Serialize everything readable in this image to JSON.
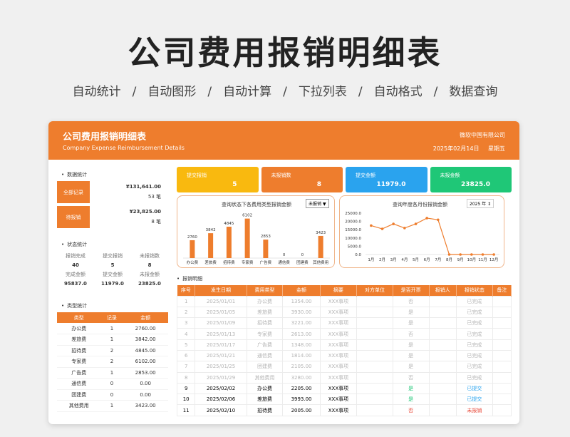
{
  "hero": {
    "title": "公司费用报销明细表",
    "features": [
      "自动统计",
      "/",
      "自动图形",
      "/",
      "自动计算",
      "/",
      "下拉列表",
      "/",
      "自动格式",
      "/",
      "数据查询"
    ]
  },
  "header": {
    "title": "公司费用报销明细表",
    "subtitle": "Company Expense Reimbursement Details",
    "company": "微软中国有限公司",
    "date": "2025年02月14日",
    "weekday": "星期五"
  },
  "left": {
    "data_stats_title": "数据统计",
    "all_records_label": "全部记录",
    "all_amount": "¥131,641.00",
    "all_count": "53 笔",
    "pending_label": "待报销",
    "pending_amount": "¥23,825.00",
    "pending_count": "8 笔",
    "status_title": "状态统计",
    "status_labels": [
      "报销完成",
      "提交报销",
      "未报销数"
    ],
    "status_counts": [
      "40",
      "5",
      "8"
    ],
    "amount_labels": [
      "完成金额",
      "提交金额",
      "未报金额"
    ],
    "amount_values": [
      "95837.0",
      "11979.0",
      "23825.0"
    ],
    "type_title": "类型统计",
    "type_headers": [
      "类型",
      "记录",
      "金额"
    ],
    "type_rows": [
      [
        "办公费",
        "1",
        "2760.00"
      ],
      [
        "差旅费",
        "1",
        "3842.00"
      ],
      [
        "招待费",
        "2",
        "4845.00"
      ],
      [
        "专家费",
        "2",
        "6102.00"
      ],
      [
        "广告费",
        "1",
        "2853.00"
      ],
      [
        "通信费",
        "0",
        "0.00"
      ],
      [
        "团建费",
        "0",
        "0.00"
      ],
      [
        "其他费用",
        "1",
        "3423.00"
      ]
    ]
  },
  "kpis": [
    {
      "label": "提交报销",
      "value": "5",
      "color": "#f9b90f"
    },
    {
      "label": "未报销数",
      "value": "8",
      "color": "#ee7d2d"
    },
    {
      "label": "提交金额",
      "value": "11979.0",
      "color": "#2aa3ee"
    },
    {
      "label": "未报金额",
      "value": "23825.0",
      "color": "#1fc777"
    }
  ],
  "bar_chart_meta": {
    "title": "查询状态下各费用类型报销金额",
    "filter": "未报销"
  },
  "line_chart_meta": {
    "title": "查询年度各月份报销金额",
    "year": "2025 年"
  },
  "chart_data": [
    {
      "type": "bar",
      "title": "查询状态下各费用类型报销金额",
      "categories": [
        "办公费",
        "差旅费",
        "招待费",
        "专家费",
        "广告费",
        "通信费",
        "团建费",
        "其他费用"
      ],
      "values": [
        2760,
        3842,
        4845,
        6102,
        2853,
        0,
        0,
        3423
      ],
      "ylim": [
        0,
        6500
      ],
      "color": "#ee7d2d"
    },
    {
      "type": "line",
      "title": "查询年度各月份报销金额",
      "categories": [
        "1月",
        "2月",
        "3月",
        "4月",
        "5月",
        "6月",
        "7月",
        "8月",
        "9月",
        "10月",
        "11月",
        "12月"
      ],
      "values": [
        17500,
        15500,
        18500,
        16000,
        18500,
        22000,
        21000,
        0,
        0,
        0,
        0,
        0
      ],
      "yticks": [
        "25000.0",
        "20000.0",
        "15000.0",
        "10000.0",
        "5000.0",
        "0.0"
      ],
      "ylim": [
        0,
        25000
      ],
      "color": "#ee7d2d"
    }
  ],
  "detail": {
    "title": "报销明细",
    "headers": [
      "序号",
      "发生日期",
      "费用类型",
      "金额",
      "摘要",
      "对方单位",
      "是否开票",
      "报销人",
      "报销状态",
      "备注"
    ],
    "rows": [
      {
        "cells": [
          "1",
          "2025/01/01",
          "办公费",
          "1354.00",
          "XXX事项",
          "",
          "否",
          "",
          "已完成",
          ""
        ],
        "faded": true,
        "invoice_color": "#b5b5b5",
        "status_color": "#b5b5b5"
      },
      {
        "cells": [
          "2",
          "2025/01/05",
          "差旅费",
          "3930.00",
          "XXX事项",
          "",
          "是",
          "",
          "已完成",
          ""
        ],
        "faded": true,
        "invoice_color": "#b5b5b5",
        "status_color": "#b5b5b5"
      },
      {
        "cells": [
          "3",
          "2025/01/09",
          "招待费",
          "3221.00",
          "XXX事项",
          "",
          "是",
          "",
          "已完成",
          ""
        ],
        "faded": true,
        "invoice_color": "#b5b5b5",
        "status_color": "#b5b5b5"
      },
      {
        "cells": [
          "4",
          "2025/01/13",
          "专家费",
          "2613.00",
          "XXX事项",
          "",
          "否",
          "",
          "已完成",
          ""
        ],
        "faded": true,
        "invoice_color": "#b5b5b5",
        "status_color": "#b5b5b5"
      },
      {
        "cells": [
          "5",
          "2025/01/17",
          "广告费",
          "1348.00",
          "XXX事项",
          "",
          "是",
          "",
          "已完成",
          ""
        ],
        "faded": true,
        "invoice_color": "#b5b5b5",
        "status_color": "#b5b5b5"
      },
      {
        "cells": [
          "6",
          "2025/01/21",
          "通信费",
          "1814.00",
          "XXX事项",
          "",
          "是",
          "",
          "已完成",
          ""
        ],
        "faded": true,
        "invoice_color": "#b5b5b5",
        "status_color": "#b5b5b5"
      },
      {
        "cells": [
          "7",
          "2025/01/25",
          "团建费",
          "2105.00",
          "XXX事项",
          "",
          "是",
          "",
          "已完成",
          ""
        ],
        "faded": true,
        "invoice_color": "#b5b5b5",
        "status_color": "#b5b5b5"
      },
      {
        "cells": [
          "8",
          "2025/01/29",
          "其他费用",
          "3280.00",
          "XXX事项",
          "",
          "否",
          "",
          "已完成",
          ""
        ],
        "faded": true,
        "invoice_color": "#b5b5b5",
        "status_color": "#b5b5b5"
      },
      {
        "cells": [
          "9",
          "2025/02/02",
          "办公费",
          "2205.00",
          "XXX事项",
          "",
          "是",
          "",
          "已提交",
          ""
        ],
        "faded": false,
        "invoice_color": "#1fc777",
        "status_color": "#2aa3ee"
      },
      {
        "cells": [
          "10",
          "2025/02/06",
          "差旅费",
          "3993.00",
          "XXX事项",
          "",
          "是",
          "",
          "已提交",
          ""
        ],
        "faded": false,
        "invoice_color": "#1fc777",
        "status_color": "#2aa3ee"
      },
      {
        "cells": [
          "11",
          "2025/02/10",
          "招待费",
          "2005.00",
          "XXX事项",
          "",
          "否",
          "",
          "未报销",
          ""
        ],
        "faded": false,
        "invoice_color": "#e84a3a",
        "status_color": "#e84a3a"
      }
    ]
  },
  "colors": {
    "accent": "#ee7d2d"
  }
}
